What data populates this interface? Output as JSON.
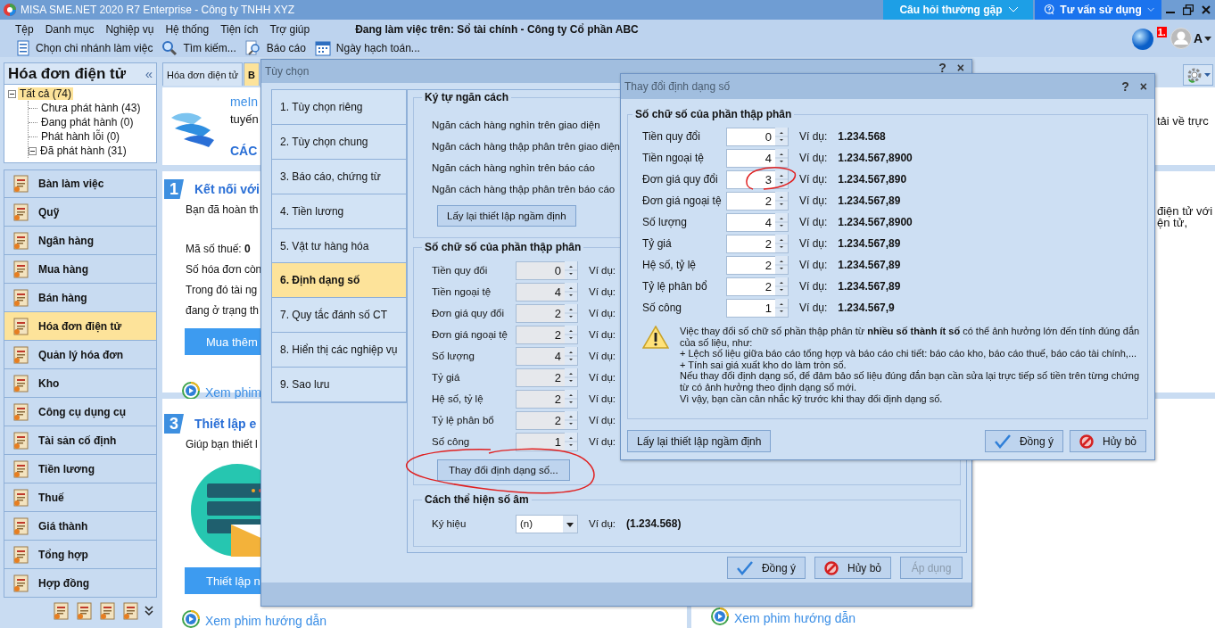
{
  "window": {
    "title": "MISA SME.NET 2020 R7 Enterprise - Công ty TNHH XYZ",
    "help_buttons": [
      {
        "label": "Câu hỏi thường gặp",
        "kind": "faq"
      },
      {
        "label": "Tư vấn sử dụng",
        "kind": "support"
      }
    ]
  },
  "menu": [
    "Tệp",
    "Danh mục",
    "Nghiệp vụ",
    "Hệ thống",
    "Tiện ích",
    "Trợ giúp"
  ],
  "working_on": "Đang làm việc trên: Sổ tài chính - Công ty Cổ phần ABC",
  "toolbar": [
    {
      "label": "Chọn chi nhánh làm việc",
      "kind": "branch"
    },
    {
      "label": "Tìm kiếm...",
      "kind": "search"
    },
    {
      "label": "Báo cáo",
      "kind": "report"
    },
    {
      "label": "Ngày hạch toán...",
      "kind": "date"
    }
  ],
  "notification_badge": "1.",
  "user": {
    "initial": "A"
  },
  "sidebar": {
    "title": "Hóa đơn điện tử",
    "collapse_glyph": "«",
    "tree": [
      {
        "label": "Tất cả (74)",
        "kind": "folder",
        "expanded": true,
        "selected": true,
        "children": [
          {
            "label": "Chưa phát hành (43)",
            "kind": "leaf",
            "selected": false
          },
          {
            "label": "Đang phát hành (0)",
            "kind": "leaf",
            "selected": false
          },
          {
            "label": "Phát hành lỗi (0)",
            "kind": "leaf",
            "selected": false
          },
          {
            "label": "Đã phát hành (31)",
            "kind": "folder",
            "expanded": true,
            "selected": false
          }
        ]
      }
    ],
    "modules": [
      {
        "label": "Bàn làm việc",
        "selected": false
      },
      {
        "label": "Quỹ",
        "selected": false
      },
      {
        "label": "Ngân hàng",
        "selected": false
      },
      {
        "label": "Mua hàng",
        "selected": false
      },
      {
        "label": "Bán hàng",
        "selected": false
      },
      {
        "label": "Hóa đơn điện tử",
        "selected": true
      },
      {
        "label": "Quản lý hóa đơn",
        "selected": false
      },
      {
        "label": "Kho",
        "selected": false
      },
      {
        "label": "Công cụ dụng cụ",
        "selected": false
      },
      {
        "label": "Tài sản cố định",
        "selected": false
      },
      {
        "label": "Tiền lương",
        "selected": false
      },
      {
        "label": "Thuế",
        "selected": false
      },
      {
        "label": "Giá thành",
        "selected": false
      },
      {
        "label": "Tổng hợp",
        "selected": false
      },
      {
        "label": "Hợp đồng",
        "selected": false
      }
    ]
  },
  "tabs": [
    {
      "label": "Hóa đơn điện tử",
      "selected": false
    },
    {
      "label": "B",
      "selected": true
    }
  ],
  "content": {
    "intro": {
      "link": "meIn",
      "text": "tuyến",
      "heading": "CÁC"
    },
    "connect_card": {
      "number": "1",
      "title": "Kết nối với",
      "lines": [
        "Bạn đã hoàn th",
        "Mã số thuế:  **0**",
        "Số hóa đơn còn",
        "Trong đó tài ng",
        "đang ở trạng th"
      ],
      "button": "Mua thêm",
      "video_link": "Xem phim"
    },
    "setup_card": {
      "number": "3",
      "title": "Thiết lập e",
      "text": "Giúp bạn thiết l",
      "button": "Thiết lập n",
      "video_link": "Xem phim hướng dẫn"
    },
    "right_column": {
      "top_text": "tải về trực",
      "lines": [
        "điện tử với",
        "ện tử,"
      ],
      "video_link": "Xem phim hướng dẫn"
    }
  },
  "options_dialog": {
    "title": "Tùy chọn",
    "help_glyph": "?",
    "close_glyph": "×",
    "nav": [
      {
        "label": "1. Tùy chọn riêng",
        "selected": false
      },
      {
        "label": "2. Tùy chọn chung",
        "selected": false
      },
      {
        "label": "3. Báo cáo, chứng từ",
        "selected": false
      },
      {
        "label": "4. Tiền lương",
        "selected": false
      },
      {
        "label": "5. Vật tư hàng hóa",
        "selected": false
      },
      {
        "label": "6. Định dạng số",
        "selected": true
      },
      {
        "label": "7. Quy tắc đánh số CT",
        "selected": false
      },
      {
        "label": "8. Hiển thị các nghiệp vụ",
        "selected": false
      },
      {
        "label": "9. Sao lưu",
        "selected": false
      }
    ],
    "separators": {
      "title": "Ký tự ngăn cách",
      "labels": [
        "Ngăn cách hàng nghìn trên giao diện",
        "Ngăn cách hàng thập phân trên giao diện",
        "Ngăn cách hàng nghìn trên báo cáo",
        "Ngăn cách hàng thập phân trên báo cáo"
      ],
      "reset_button": "Lấy lại thiết lập ngầm định"
    },
    "decimals": {
      "title": "Số chữ số của phần thập phân",
      "rows": [
        {
          "label": "Tiền quy đổi",
          "value": "0",
          "disabled": true,
          "example_label": "Ví dụ:"
        },
        {
          "label": "Tiền ngoại tệ",
          "value": "4",
          "disabled": true,
          "example_label": "Ví dụ:"
        },
        {
          "label": "Đơn giá quy đổi",
          "value": "2",
          "disabled": true,
          "example_label": "Ví dụ:"
        },
        {
          "label": "Đơn giá ngoại tệ",
          "value": "2",
          "disabled": true,
          "example_label": "Ví dụ:"
        },
        {
          "label": "Số lượng",
          "value": "4",
          "disabled": true,
          "example_label": "Ví dụ:"
        },
        {
          "label": "Tỷ giá",
          "value": "2",
          "disabled": true,
          "example_label": "Ví dụ:"
        },
        {
          "label": "Hệ số, tỷ lệ",
          "value": "2",
          "disabled": true,
          "example_label": "Ví dụ:"
        },
        {
          "label": "Tỷ lệ phân bổ",
          "value": "2",
          "disabled": true,
          "example_label": "Ví dụ:"
        },
        {
          "label": "Số công",
          "value": "1",
          "disabled": true,
          "example_label": "Ví dụ:"
        }
      ],
      "change_button": {
        "label": "Thay đổi định dạng số...",
        "circled": true
      }
    },
    "negative": {
      "title": "Cách thể hiện số âm",
      "label": "Ký hiệu",
      "value": "(n)",
      "example_label": "Ví dụ:",
      "example": "(1.234.568)"
    },
    "buttons": [
      {
        "label": "Đồng ý",
        "kind": "ok",
        "disabled": false
      },
      {
        "label": "Hủy bỏ",
        "kind": "cancel",
        "disabled": false
      },
      {
        "label": "Áp dụng",
        "kind": "apply",
        "disabled": true
      }
    ]
  },
  "format_dialog": {
    "title": "Thay đổi định dạng số",
    "help_glyph": "?",
    "close_glyph": "×",
    "group_title": "Số chữ số của phần thập phân",
    "rows": [
      {
        "label": "Tiền quy đổi",
        "value": "0",
        "disabled": false,
        "circled": false,
        "example_label": "Ví dụ:",
        "example": "1.234.568"
      },
      {
        "label": "Tiền ngoại tệ",
        "value": "4",
        "disabled": false,
        "circled": false,
        "example_label": "Ví dụ:",
        "example": "1.234.567,8900"
      },
      {
        "label": "Đơn giá quy đổi",
        "value": "3",
        "disabled": false,
        "circled": true,
        "example_label": "Ví dụ:",
        "example": "1.234.567,890"
      },
      {
        "label": "Đơn giá ngoại tệ",
        "value": "2",
        "disabled": false,
        "circled": false,
        "example_label": "Ví dụ:",
        "example": "1.234.567,89"
      },
      {
        "label": "Số lượng",
        "value": "4",
        "disabled": false,
        "circled": false,
        "example_label": "Ví dụ:",
        "example": "1.234.567,8900"
      },
      {
        "label": "Tỷ giá",
        "value": "2",
        "disabled": false,
        "circled": false,
        "example_label": "Ví dụ:",
        "example": "1.234.567,89"
      },
      {
        "label": "Hệ số, tỷ lệ",
        "value": "2",
        "disabled": false,
        "circled": false,
        "example_label": "Ví dụ:",
        "example": "1.234.567,89"
      },
      {
        "label": "Tỷ lệ phân bổ",
        "value": "2",
        "disabled": false,
        "circled": false,
        "example_label": "Ví dụ:",
        "example": "1.234.567,89"
      },
      {
        "label": "Số công",
        "value": "1",
        "disabled": false,
        "circled": false,
        "example_label": "Ví dụ:",
        "example": "1.234.567,9"
      }
    ],
    "warning": [
      "Việc thay đổi số chữ số phần thập phân từ **nhiều số thành ít số** có thể ảnh hưởng lớn đến tính đúng đắn của số liệu, như:",
      "+ Lệch số liệu giữa báo cáo tổng hợp và báo cáo chi tiết: báo cáo kho, báo cáo thuế, báo cáo tài chính,...",
      "+ Tính sai giá xuất kho do làm tròn số.",
      "Nếu thay đổi định dạng số, để đảm bảo số liệu đúng đắn bạn cần sửa lại trực tiếp số tiền trên từng chứng từ có ảnh hưởng theo định dạng số mới.",
      "Vì vậy, bạn cần cân nhắc kỹ trước khi thay đổi định dạng số."
    ],
    "reset_button": "Lấy lại thiết lập ngầm định",
    "buttons": [
      {
        "label": "Đồng ý",
        "kind": "ok",
        "disabled": false
      },
      {
        "label": "Hủy bỏ",
        "kind": "cancel",
        "disabled": false
      }
    ]
  }
}
